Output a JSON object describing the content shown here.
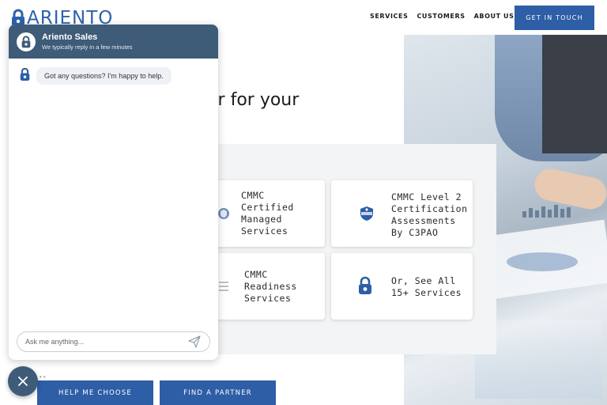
{
  "header": {
    "logo_text": "ARIENTO",
    "nav": [
      "SERVICES",
      "CUSTOMERS",
      "ABOUT US"
    ],
    "cta_label": "GET IN TOUCH"
  },
  "hero": {
    "heading_fragment": "er for your"
  },
  "services": [
    {
      "label": "CMMC Certified Managed Services",
      "icon": "shield-badge-icon"
    },
    {
      "label": "CMMC Level 2 Certification Assessments By C3PAO",
      "icon": "cyberab-seal-icon"
    },
    {
      "label": "CMMC Readiness Services",
      "icon": "checklist-icon"
    },
    {
      "label": "Or, See All 15+ Services",
      "icon": "lock-icon"
    }
  ],
  "buttons": {
    "help_choose": "HELP ME CHOOSE",
    "find_partner": "FIND A PARTNER"
  },
  "chat": {
    "title": "Ariento Sales",
    "subtitle": "We typically reply in a few minutes",
    "message": "Got any questions? I'm happy to help.",
    "input_placeholder": "Ask me anything...",
    "icons": [
      "lock-icon",
      "send-icon",
      "close-icon"
    ]
  },
  "colors": {
    "brand_blue": "#2d5ea6",
    "chat_header": "#3e5b78",
    "panel_bg": "#f3f4f5"
  }
}
